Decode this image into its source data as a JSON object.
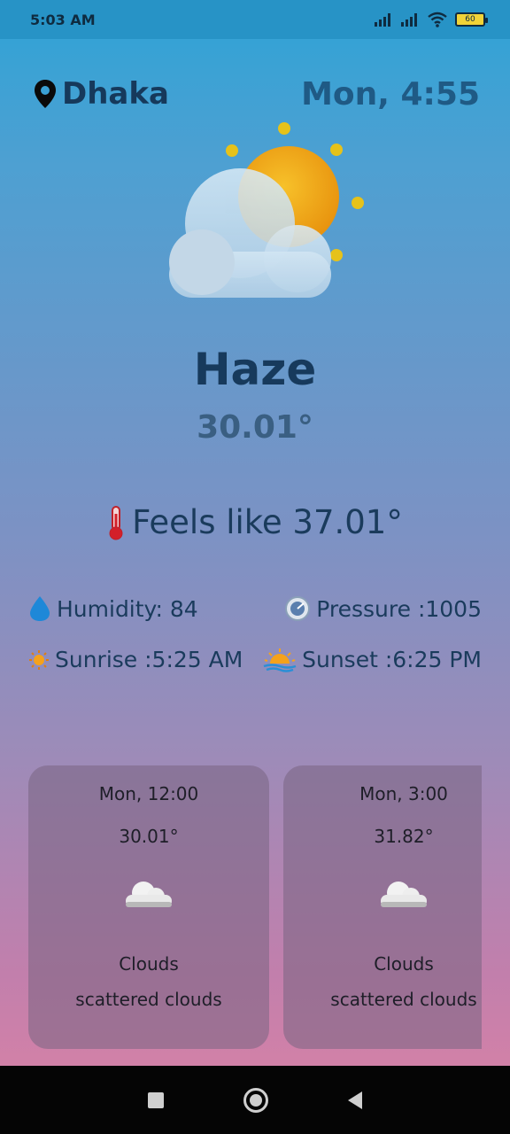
{
  "status_bar": {
    "time": "5:03 AM",
    "battery": "60"
  },
  "header": {
    "location": "Dhaka",
    "datetime": "Mon, 4:55"
  },
  "current": {
    "condition": "Haze",
    "temperature": "30.01°",
    "feels_like": "Feels like 37.01°"
  },
  "details": {
    "humidity": "Humidity: 84",
    "pressure": "Pressure :1005",
    "sunrise": "Sunrise :5:25 AM",
    "sunset": "Sunset :6:25 PM"
  },
  "forecast": [
    {
      "time": "Mon, 12:00",
      "temp": "30.01°",
      "icon": "cloud-icon",
      "main": "Clouds",
      "description": "scattered clouds"
    },
    {
      "time": "Mon, 3:00",
      "temp": "31.82°",
      "icon": "cloud-icon",
      "main": "Clouds",
      "description": "scattered clouds"
    }
  ],
  "colors": {
    "title": "#173a5c",
    "accent": "#1f5a85",
    "card": "#7a6a86"
  }
}
